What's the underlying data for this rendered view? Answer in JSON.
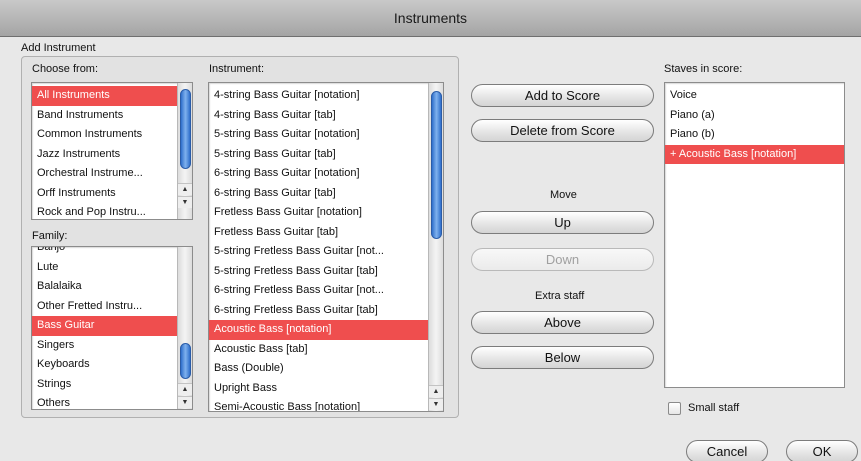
{
  "window": {
    "title": "Instruments"
  },
  "add_instrument": {
    "label": "Add Instrument"
  },
  "choose_from": {
    "label": "Choose from:",
    "items": [
      {
        "label": "All Instruments",
        "selected": true
      },
      {
        "label": "Band Instruments",
        "selected": false
      },
      {
        "label": "Common Instruments",
        "selected": false
      },
      {
        "label": "Jazz Instruments",
        "selected": false
      },
      {
        "label": "Orchestral Instrume...",
        "selected": false
      },
      {
        "label": "Orff Instruments",
        "selected": false
      },
      {
        "label": "Rock and Pop Instru...",
        "selected": false
      }
    ]
  },
  "family": {
    "label": "Family:",
    "items": [
      {
        "label": "Banjo",
        "selected": false
      },
      {
        "label": "Lute",
        "selected": false
      },
      {
        "label": "Balalaika",
        "selected": false
      },
      {
        "label": "Other Fretted Instru...",
        "selected": false
      },
      {
        "label": "Bass Guitar",
        "selected": true
      },
      {
        "label": "Singers",
        "selected": false
      },
      {
        "label": "Keyboards",
        "selected": false
      },
      {
        "label": "Strings",
        "selected": false
      },
      {
        "label": "Others",
        "selected": false
      }
    ]
  },
  "instrument": {
    "label": "Instrument:",
    "items": [
      {
        "label": "4-string Bass Guitar [notation]",
        "selected": false
      },
      {
        "label": "4-string Bass Guitar [tab]",
        "selected": false
      },
      {
        "label": "5-string Bass Guitar [notation]",
        "selected": false
      },
      {
        "label": "5-string Bass Guitar [tab]",
        "selected": false
      },
      {
        "label": "6-string Bass Guitar [notation]",
        "selected": false
      },
      {
        "label": "6-string Bass Guitar [tab]",
        "selected": false
      },
      {
        "label": "Fretless Bass Guitar [notation]",
        "selected": false
      },
      {
        "label": "Fretless Bass Guitar [tab]",
        "selected": false
      },
      {
        "label": "5-string Fretless Bass Guitar [not...",
        "selected": false
      },
      {
        "label": "5-string Fretless Bass Guitar [tab]",
        "selected": false
      },
      {
        "label": "6-string Fretless Bass Guitar [not...",
        "selected": false
      },
      {
        "label": "6-string Fretless Bass Guitar [tab]",
        "selected": false
      },
      {
        "label": "Acoustic Bass [notation]",
        "selected": true
      },
      {
        "label": "Acoustic Bass [tab]",
        "selected": false
      },
      {
        "label": "Bass (Double)",
        "selected": false
      },
      {
        "label": "Upright Bass",
        "selected": false
      },
      {
        "label": "Semi-Acoustic Bass [notation]",
        "selected": false
      }
    ]
  },
  "actions": {
    "add_to_score": "Add to Score",
    "delete_from_score": "Delete from Score",
    "move_label": "Move",
    "up": "Up",
    "down": "Down",
    "extra_staff_label": "Extra staff",
    "above": "Above",
    "below": "Below"
  },
  "staves": {
    "label": "Staves in score:",
    "items": [
      {
        "label": "Voice",
        "selected": false
      },
      {
        "label": "Piano (a)",
        "selected": false
      },
      {
        "label": "Piano (b)",
        "selected": false
      },
      {
        "label": "+ Acoustic Bass [notation]",
        "selected": true
      }
    ]
  },
  "small_staff": {
    "label": "Small staff",
    "checked": false
  },
  "footer": {
    "cancel": "Cancel",
    "ok": "OK"
  },
  "colors": {
    "selection": "#ef4e4e",
    "scroll_thumb": "#3d7ad6"
  },
  "icons": {
    "scroll_up": "up-arrow-icon",
    "scroll_down": "down-arrow-icon"
  }
}
